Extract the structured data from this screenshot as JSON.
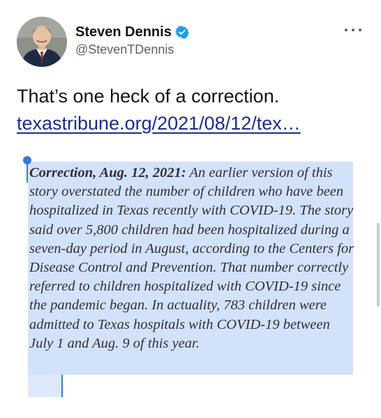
{
  "author": {
    "display_name": "Steven Dennis",
    "handle": "@StevenTDennis",
    "verified": true,
    "verified_icon": "verified-badge-icon",
    "avatar_icon": "profile-avatar"
  },
  "menu": {
    "icon": "more-options-icon"
  },
  "tweet": {
    "text": "That’s one heck of a correction.",
    "link": "texastribune.org/2021/08/12/tex…"
  },
  "quote": {
    "lead": "Correction, Aug. 12, 2021:",
    "body": " An earlier version of this story overstated the number of children who have been hospitalized in Texas recently with COVID-19. The story said over 5,800 children had been hospitalized during a seven-day period in August, according to the Centers for Disease Control and Prevention. That number correctly referred to children hospitalized with COVID-19 since the pandemic began. In actuality, 783 children were admitted to Texas hospitals with COVID-19 between July 1 and Aug. 9 of this year."
  },
  "colors": {
    "selection": "#d3e2fb",
    "selection_handle": "#3a7bd5",
    "verified": "#1d9bf0",
    "link": "#1d2d8a",
    "handle_text": "#536471"
  }
}
